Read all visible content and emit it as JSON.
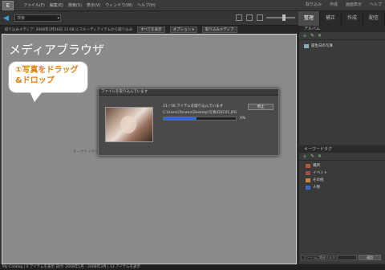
{
  "app": {
    "logo": "E"
  },
  "menu": {
    "items": [
      "ファイル(F)",
      "編集(E)",
      "検索(S)",
      "表示(V)",
      "ウィンドウ(W)",
      "ヘルプ(H)"
    ],
    "right": [
      "取り込み",
      "作成",
      "画面表示",
      "ヘルプ"
    ]
  },
  "toolbar": {
    "search_placeholder": "検索"
  },
  "tabs": [
    "整理",
    "補正",
    "作成",
    "配信"
  ],
  "subbar": {
    "text": "取り込みメディア: 2008年1月16日 11:08 にフルーディアイテムから取り込み",
    "btn1": "すべてを表示",
    "btn2": "オプション ▾",
    "btn3": "取り込みメディア"
  },
  "main": {
    "title": "メディアブラウザ",
    "placeholder": "オーガナイザー"
  },
  "callout": {
    "line1": "①写真をドラッグ",
    "line2": "&ドロップ"
  },
  "dialog": {
    "title": "ファイルを取り込んでいます",
    "status": "21 / 56 アイテムを取り込んでいます",
    "path": "C:\\Users\\Tanaka\\Desktop\\写真\\DSC01.JPG",
    "progress_pct": 45,
    "pct_label": "0%",
    "stop_button": "停止"
  },
  "panels": {
    "album": {
      "header": "アルバム",
      "item": "誕生日の写真"
    },
    "tags": {
      "header": "キーワードタグ",
      "items": [
        {
          "label": "場所",
          "color": "#b05a3a"
        },
        {
          "label": "イベント",
          "color": "#a0504a"
        },
        {
          "label": "その他",
          "color": "#c08a40"
        },
        {
          "label": "人物",
          "color": "#3a6ac0"
        }
      ],
      "footer_input": "ファイルに関連するタグ",
      "footer_button": "適用"
    }
  },
  "status": {
    "text": "My Catalog  |  0 アイテムを表示 日付: 2008年1月 - 2008年3月  |  13 アイテムを表示"
  }
}
